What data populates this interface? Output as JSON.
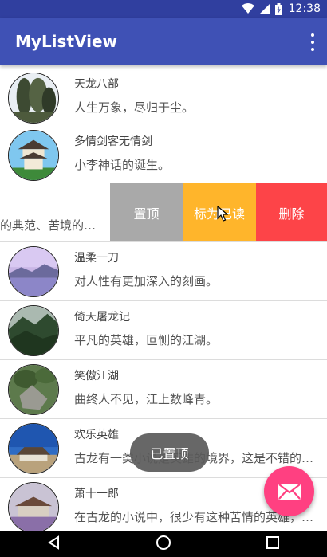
{
  "status_bar": {
    "time": "12:38"
  },
  "app_bar": {
    "title": "MyListView"
  },
  "list": [
    {
      "title": "天龙八部",
      "subtitle": "人生万象，尽归于尘。"
    },
    {
      "title": "多情剑客无情剑",
      "subtitle": "小李神话的诞生。"
    },
    {
      "title": "",
      "subtitle": "的典范、苦境的诞生。"
    },
    {
      "title": "温柔一刀",
      "subtitle": "对人性有更加深入的刻画。"
    },
    {
      "title": "倚天屠龙记",
      "subtitle": "平凡的英雄，叵恻的江湖。"
    },
    {
      "title": "笑傲江湖",
      "subtitle": "曲终人不见，江上数峰青。"
    },
    {
      "title": "欢乐英雄",
      "subtitle": "古龙有一类小说是英雄的境界，这是不错的作品。"
    },
    {
      "title": "萧十一郎",
      "subtitle": "在古龙的小说中，很少有这种苦情的英雄，这是一部。"
    }
  ],
  "swipe_actions": {
    "pin": "置顶",
    "mark_read": "标为已读",
    "delete": "删除"
  },
  "toast": "已置顶",
  "colors": {
    "primary": "#3f51b5",
    "primary_dark": "#303f9f",
    "accent": "#ff4081",
    "pin": "#a9a9a9",
    "mark_read": "#ffb52b",
    "delete": "#fd4448"
  }
}
